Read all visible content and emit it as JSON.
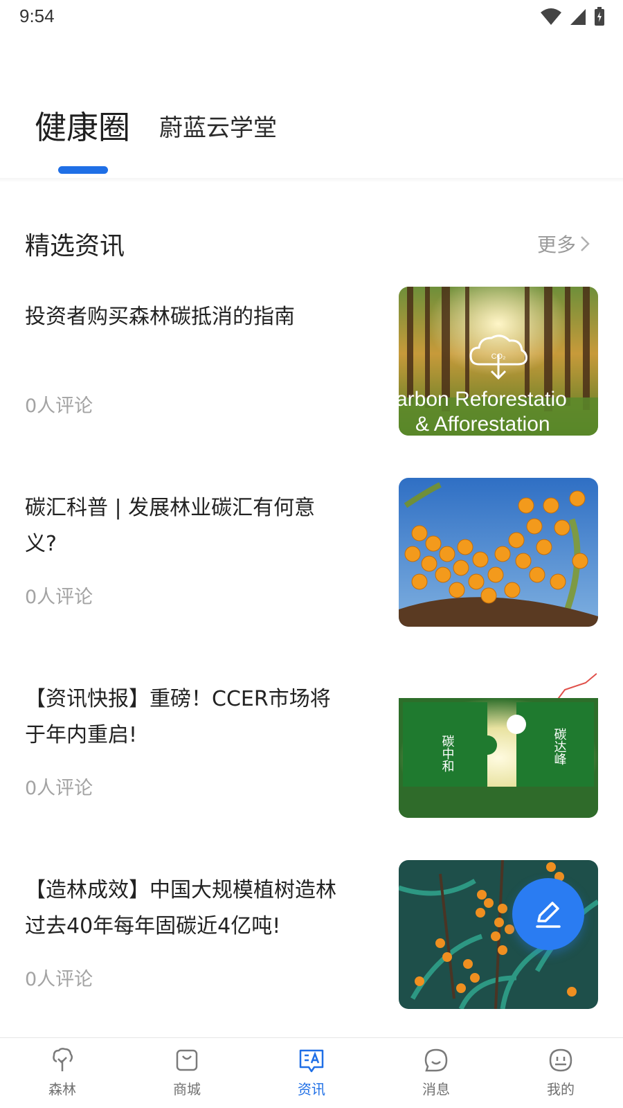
{
  "status_bar": {
    "time": "9:54"
  },
  "top_tabs": {
    "main": "健康圈",
    "second": "蔚蓝云学堂"
  },
  "section": {
    "title": "精选资讯",
    "more": "更多"
  },
  "news": [
    {
      "title": "投资者购买森林碳抵消的指南",
      "comments": "0人评论",
      "image_text_1": "arbon Reforestatio",
      "image_text_2": "& Afforestation",
      "image_badge": "CO₂"
    },
    {
      "title": "碳汇科普 | 发展林业碳汇有何意义?",
      "comments": "0人评论"
    },
    {
      "title": "【资讯快报】重磅！CCER市场将于年内重启!",
      "comments": "0人评论",
      "image_text_1": "碳中和",
      "image_text_2": "碳达峰"
    },
    {
      "title": "【造林成效】中国大规模植树造林过去40年每年固碳近4亿吨!",
      "comments": "0人评论"
    }
  ],
  "bottom_nav": [
    {
      "label": "森林",
      "icon": "forest-icon",
      "active": false
    },
    {
      "label": "商城",
      "icon": "shop-bag-icon",
      "active": false
    },
    {
      "label": "资讯",
      "icon": "news-icon",
      "active": true
    },
    {
      "label": "消息",
      "icon": "message-icon",
      "active": false
    },
    {
      "label": "我的",
      "icon": "profile-icon",
      "active": false
    }
  ],
  "colors": {
    "accent": "#1f6fe6",
    "fab": "#2a7cf2",
    "muted": "#a3a3a3"
  }
}
